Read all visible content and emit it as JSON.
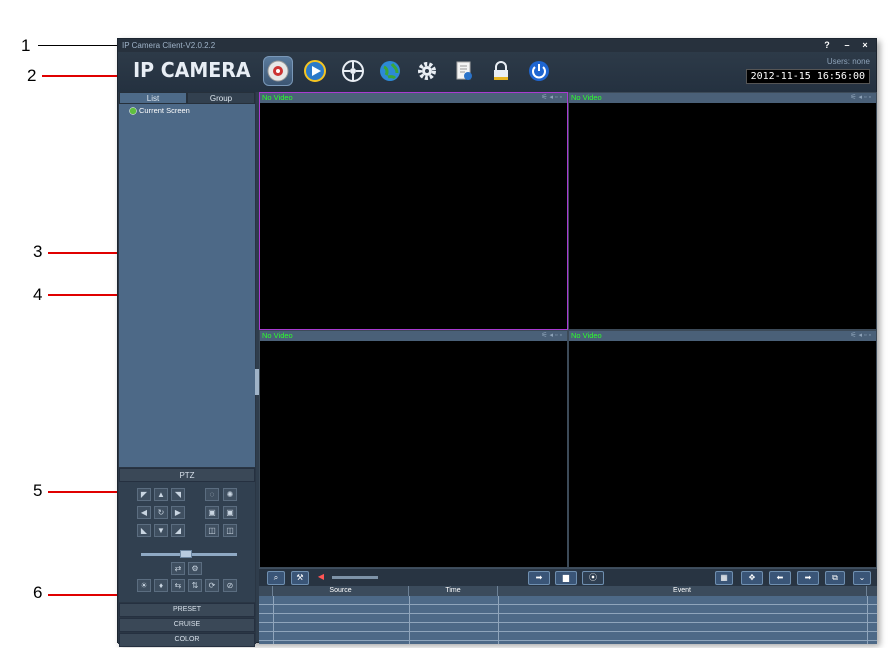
{
  "window": {
    "title": "IP Camera Client-V2.0.2.2",
    "help": "?",
    "minimize": "–",
    "close": "×"
  },
  "header": {
    "logo": "IP CAMERA",
    "users": "Users: none",
    "datetime": "2012-11-15 16:56:00",
    "toolbar_icons": [
      "surveillance-icon",
      "playback-icon",
      "ptz-settings-icon",
      "network-icon",
      "settings-icon",
      "log-icon",
      "lock-icon",
      "power-icon"
    ]
  },
  "left": {
    "tabs": [
      "List",
      "Group"
    ],
    "device": "Current Screen",
    "ptz_header": "PTZ",
    "bottom_tabs": [
      "PRESET",
      "CRUISE",
      "COLOR"
    ]
  },
  "video": {
    "cells": [
      "No Video",
      "No Video",
      "No Video",
      "No Video"
    ],
    "selected": 0
  },
  "events": {
    "columns": [
      "Source",
      "Time",
      "Event"
    ]
  },
  "callouts": [
    "1",
    "2",
    "3",
    "4",
    "5",
    "6"
  ],
  "colors": {
    "accent": "#4d6987",
    "selected_border": "#a93bd1",
    "no_video": "#2cff2c",
    "arrow": "#e00000"
  }
}
